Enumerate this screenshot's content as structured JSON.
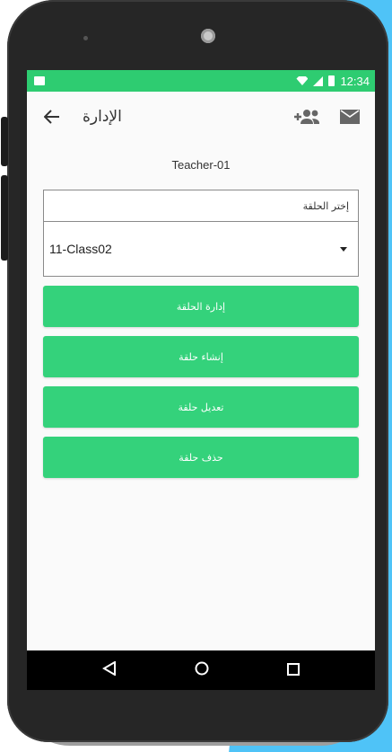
{
  "status_bar": {
    "time": "12:34",
    "icons": [
      "image-icon",
      "wifi-icon",
      "signal-icon",
      "battery-icon"
    ]
  },
  "toolbar": {
    "title": "الإدارة",
    "back_icon": "arrow-back-icon",
    "add_icon": "add-group-icon",
    "mail_icon": "mail-icon"
  },
  "main": {
    "teacher_name": "Teacher-01",
    "select_label": "إختر الحلقة",
    "select_value": "11-Class02"
  },
  "buttons": [
    {
      "label": "إدارة الحلقة"
    },
    {
      "label": "إنشاء حلقة"
    },
    {
      "label": "تعديل حلقة"
    },
    {
      "label": "حذف حلقة"
    }
  ],
  "navbar": {
    "icons": [
      "back-nav-icon",
      "home-nav-icon",
      "recents-nav-icon"
    ]
  },
  "colors": {
    "accent": "#2ecc71",
    "button": "#34d27b",
    "backdrop": "#4fc3f7"
  }
}
